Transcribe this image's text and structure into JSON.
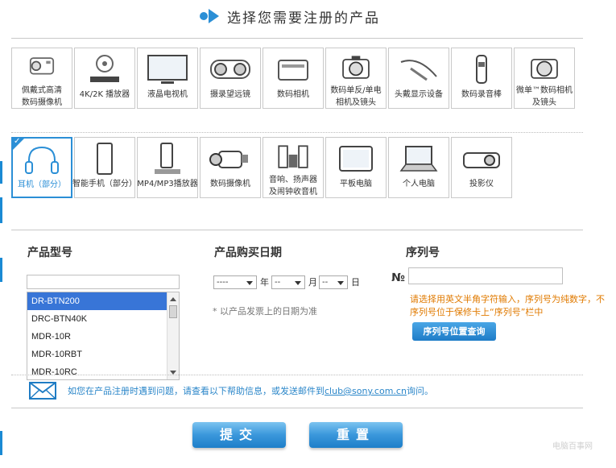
{
  "header": {
    "title": "选择您需要注册的产品"
  },
  "categories_row1": [
    {
      "label1": "佩戴式高清",
      "label2": "数码摄像机",
      "icon": "action-cam-icon"
    },
    {
      "label1": "4K/2K 播放器",
      "label2": "",
      "icon": "media-player-icon"
    },
    {
      "label1": "液晶电视机",
      "label2": "",
      "icon": "lcd-tv-icon"
    },
    {
      "label1": "摄录望远镜",
      "label2": "",
      "icon": "binoculars-icon"
    },
    {
      "label1": "数码相机",
      "label2": "",
      "icon": "compact-camera-icon"
    },
    {
      "label1": "数码单反/单电",
      "label2": "相机及镜头",
      "icon": "dslr-camera-icon"
    },
    {
      "label1": "头戴显示设备",
      "label2": "",
      "icon": "head-mounted-display-icon"
    },
    {
      "label1": "数码录音棒",
      "label2": "",
      "icon": "voice-recorder-icon"
    },
    {
      "label1": "微单™数码相机",
      "label2": "及镜头",
      "icon": "mirrorless-camera-icon"
    }
  ],
  "categories_row2": [
    {
      "label1": "耳机（部分）",
      "label2": "",
      "icon": "headphones-icon",
      "selected": true
    },
    {
      "label1": "智能手机（部分）",
      "label2": "",
      "icon": "smartphone-icon"
    },
    {
      "label1": "MP4/MP3播放器",
      "label2": "",
      "icon": "mp3-player-icon"
    },
    {
      "label1": "数码摄像机",
      "label2": "",
      "icon": "camcorder-icon"
    },
    {
      "label1": "音响、扬声器",
      "label2": "及闹钟收音机",
      "icon": "speaker-icon"
    },
    {
      "label1": "平板电脑",
      "label2": "",
      "icon": "tablet-icon"
    },
    {
      "label1": "个人电脑",
      "label2": "",
      "icon": "laptop-icon"
    },
    {
      "label1": "投影仪",
      "label2": "",
      "icon": "projector-icon"
    }
  ],
  "form": {
    "model_label": "产品型号",
    "date_label": "产品购买日期",
    "serial_label": "序列号",
    "model_options": [
      "DR-BTN200",
      "DRC-BTN40K",
      "MDR-10R",
      "MDR-10RBT",
      "MDR-10RC"
    ],
    "model_selected": "DR-BTN200",
    "year_value": "----",
    "year_unit": "年",
    "month_value": "--",
    "month_unit": "月",
    "day_value": "--",
    "day_unit": "日",
    "date_note": "* 以产品发票上的日期为准",
    "serial_prefix": "№",
    "serial_hint_line1": "请选择用英文半角字符输入，序列号为纯数字，不",
    "serial_hint_line2": "序列号位于保修卡上“序列号”栏中",
    "serial_lookup_button": "序列号位置查询"
  },
  "help": {
    "text_before": "如您在产品注册时遇到问题，请查看以下帮助信息，或发送邮件到",
    "email": "club@sony.com.cn",
    "text_after": "询问。"
  },
  "buttons": {
    "submit": "提交",
    "reset": "重置"
  },
  "watermark": "电脑百事网",
  "colors": {
    "accent": "#2b8fd6",
    "hint": "#e07a00",
    "link": "#2a86c9",
    "selected_item": "#3875d7"
  }
}
